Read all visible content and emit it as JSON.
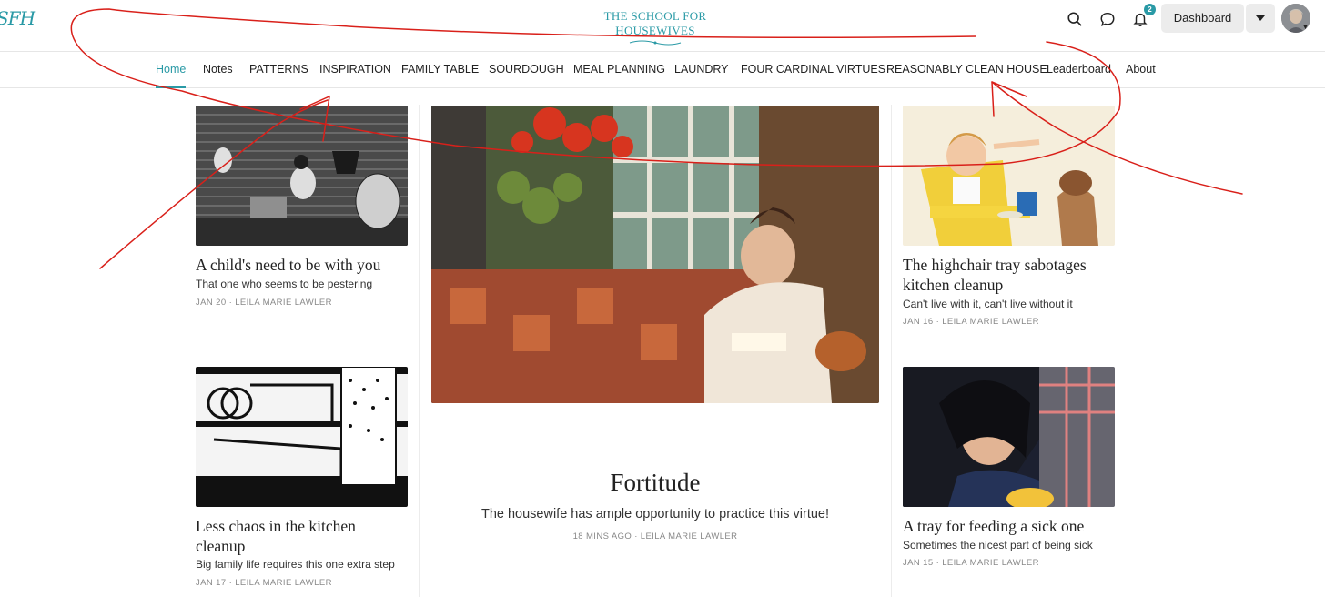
{
  "header": {
    "logo_mark": "SFH",
    "site_title": "THE SCHOOL FOR HOUSEWIVES",
    "notification_count": "2",
    "dashboard_label": "Dashboard",
    "icons": [
      "search-icon",
      "chat-icon",
      "bell-icon",
      "caret-down-icon"
    ]
  },
  "nav": {
    "items": [
      {
        "label": "Home",
        "active": true
      },
      {
        "label": "Notes"
      },
      {
        "label": "PATTERNS"
      },
      {
        "label": "INSPIRATION"
      },
      {
        "label": "FAMILY TABLE"
      },
      {
        "label": "SOURDOUGH"
      },
      {
        "label": "MEAL PLANNING"
      },
      {
        "label": "LAUNDRY"
      },
      {
        "label": "FOUR CARDINAL VIRTUES"
      },
      {
        "label": "REASONABLY CLEAN HOUSE"
      },
      {
        "label": "Leaderboard"
      },
      {
        "label": "About"
      }
    ]
  },
  "featured": {
    "title": "Fortitude",
    "subtitle": "The housewife has ample opportunity to practice this virtue!",
    "meta": "18 MINS AGO · LEILA MARIE LAWLER"
  },
  "posts": [
    {
      "title": "A child's need to be with you",
      "subtitle": "That one who seems to be pestering",
      "meta": "JAN 20 · LEILA MARIE LAWLER"
    },
    {
      "title": "Less chaos in the kitchen cleanup",
      "subtitle": "Big family life requires this one extra step",
      "meta": "JAN 17 · LEILA MARIE LAWLER"
    },
    {
      "title": "The highchair tray sabotages kitchen cleanup",
      "subtitle": "Can't live with it, can't live without it",
      "meta": "JAN 16 · LEILA MARIE LAWLER"
    },
    {
      "title": "A tray for feeding a sick one",
      "subtitle": "Sometimes the nicest part of being sick",
      "meta": "JAN 15 · LEILA MARIE LAWLER"
    }
  ],
  "colors": {
    "accent": "#2a9aa6",
    "annotation": "#d9201a"
  }
}
